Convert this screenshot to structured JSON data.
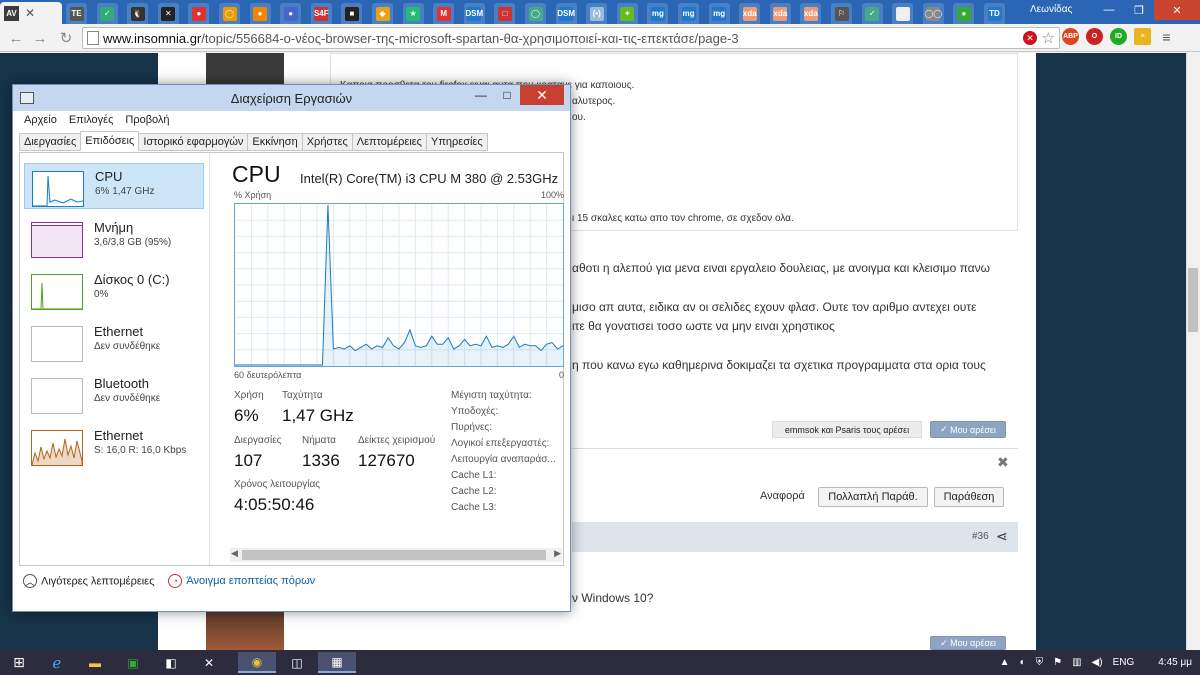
{
  "browser": {
    "active_tab_favicon": "AV",
    "user": "Λεωνίδας",
    "url_host": "www.insomnia.gr",
    "url_path": "/topic/556684-ο-νέος-browser-της-microsoft-spartan-θα-χρησιμοποιεί-και-τις-επεκτάσε/page-3",
    "tab_favicons": [
      "TE",
      "✓",
      "🐧",
      "✕",
      "●",
      "◯",
      "●",
      "●",
      "S4F",
      "■",
      "◆",
      "★",
      "M",
      "DSM",
      "□",
      "◯",
      "DSM",
      "(•)",
      "✦",
      "mg",
      "mg",
      "mg",
      "xda",
      "xda",
      "xda",
      "⚐",
      "✓",
      "□",
      "◯◯",
      "●",
      "TD"
    ]
  },
  "page": {
    "post_lines": [
      "Καποια προσθετα του firefox ειναι αυτα που κρατανε για καποιους.",
      "αλυτερος.",
      "ου."
    ],
    "post_line4": "ι 15 σκαλες κατω απο τον chrome, σε σχεδον ολα.",
    "para1": "αθοτι η αλεπού για μενα ειναι εργαλειο δουλειας, με ανοιγμα και κλεισιμο πανω",
    "para2a": "μισο απ αυτα, ειδικα αν οι σελιδες εχουν φλασ. Ουτε τον αριθμο αντεχει ουτε",
    "para2b": "ιτε θα γονατισει τοσο ωστε να μην ειναι χρηστικος",
    "para3": "η που κανω εγω καθημερινα δοκιμαζει τα σχετικα προγραμματα στα ορια τους",
    "likes": "emmsok και Psaris τους αρέσει",
    "like_button": "Μου αρέσει",
    "report": "Αναφορά",
    "multi_quote": "Πολλαπλή Παράθ.",
    "quote": "Παράθεση",
    "post_number": "#36",
    "next_post_text": "ν Windows 10?",
    "like_button_2": "Μου αρέσει"
  },
  "taskmanager": {
    "title": "Διαχείριση Εργασιών",
    "menu": [
      "Αρχείο",
      "Επιλογές",
      "Προβολή"
    ],
    "tabs": [
      "Διεργασίες",
      "Επιδόσεις",
      "Ιστορικό εφαρμογών",
      "Εκκίνηση",
      "Χρήστες",
      "Λεπτομέρειες",
      "Υπηρεσίες"
    ],
    "resources": [
      {
        "name": "CPU",
        "value": "6% 1,47 GHz",
        "color": "#1a7bc0"
      },
      {
        "name": "Μνήμη",
        "value": "3,6/3,8 GB (95%)",
        "color": "#8b2ca5"
      },
      {
        "name": "Δίσκος 0 (C:)",
        "value": "0%",
        "color": "#4da31b"
      },
      {
        "name": "Ethernet",
        "value": "Δεν συνδέθηκε",
        "color": "#aaaaaa"
      },
      {
        "name": "Bluetooth",
        "value": "Δεν συνδέθηκε",
        "color": "#aaaaaa"
      },
      {
        "name": "Ethernet",
        "value": "S: 16,0  R: 16,0 Kbps",
        "color": "#b8621b"
      }
    ],
    "detail": {
      "heading": "CPU",
      "model": "Intel(R) Core(TM) i3 CPU M 380 @ 2.53GHz",
      "y_label": "% Χρήση",
      "y_max_label": "100%",
      "x_label": "60 δευτερόλεπτα",
      "x_min_label": "0",
      "usage_label": "Χρήση",
      "usage": "6%",
      "speed_label": "Ταχύτητα",
      "speed": "1,47 GHz",
      "processes_label": "Διεργασίες",
      "processes": "107",
      "threads_label": "Νήματα",
      "threads": "1336",
      "handles_label": "Δείκτες χειρισμού",
      "handles": "127670",
      "uptime_label": "Χρόνος λειτουργίας",
      "uptime": "4:05:50:46",
      "right_labels": [
        "Μέγιστη ταχύτητα:",
        "Υποδοχές:",
        "Πυρήνες:",
        "Λογικοί επεξεργαστές:",
        "Λειτουργία αναπαράσ...",
        "Cache L1:",
        "Cache L2:",
        "Cache L3:"
      ]
    },
    "cpu_history": [
      0,
      0,
      0,
      0,
      0,
      0,
      0,
      0,
      0,
      0,
      0,
      0,
      0,
      0,
      0,
      0,
      0,
      100,
      10,
      11,
      10,
      12,
      9,
      11,
      13,
      10,
      12,
      11,
      17,
      12,
      10,
      14,
      22,
      12,
      11,
      12,
      18,
      13,
      13,
      17,
      10,
      12,
      16,
      12,
      13,
      12,
      18,
      11,
      12,
      11,
      13,
      18,
      11,
      13,
      12,
      12,
      9,
      13,
      14,
      10,
      12
    ],
    "fewer_details": "Λιγότερες λεπτομέρειες",
    "open_monitor": "Άνοιγμα εποπτείας πόρων"
  },
  "taskbar": {
    "lang": "ENG",
    "time": "4:45 μμ"
  }
}
